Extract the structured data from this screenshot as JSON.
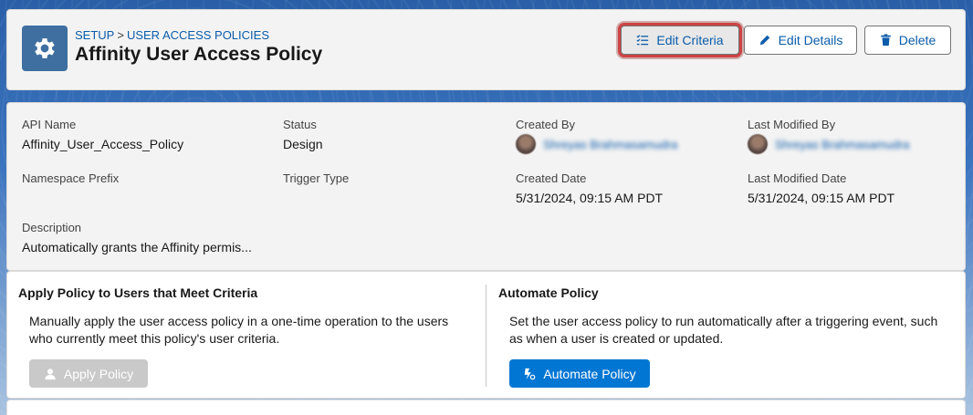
{
  "header": {
    "breadcrumb": {
      "root": "SETUP",
      "separator": ">",
      "current": "USER ACCESS POLICIES"
    },
    "title": "Affinity User Access Policy",
    "icon": "gear-icon",
    "buttons": {
      "edit_criteria": "Edit Criteria",
      "edit_details": "Edit Details",
      "delete": "Delete"
    }
  },
  "details": {
    "api_name": {
      "label": "API Name",
      "value": "Affinity_User_Access_Policy"
    },
    "status": {
      "label": "Status",
      "value": "Design"
    },
    "created_by": {
      "label": "Created By",
      "value": "Shreyas Brahmasamudra"
    },
    "last_modified_by": {
      "label": "Last Modified By",
      "value": "Shreyas Brahmasamudra"
    },
    "namespace_prefix": {
      "label": "Namespace Prefix",
      "value": ""
    },
    "trigger_type": {
      "label": "Trigger Type",
      "value": ""
    },
    "created_date": {
      "label": "Created Date",
      "value": "5/31/2024, 09:15 AM PDT"
    },
    "last_modified_date": {
      "label": "Last Modified Date",
      "value": "5/31/2024, 09:15 AM PDT"
    },
    "description": {
      "label": "Description",
      "value": "Automatically grants the Affinity permis..."
    }
  },
  "apply_section": {
    "title": "Apply Policy to Users that Meet Criteria",
    "text": "Manually apply the user access policy in a one-time operation to the users who currently meet this policy's user criteria.",
    "button": "Apply Policy"
  },
  "automate_section": {
    "title": "Automate Policy",
    "text": "Set the user access policy to run automatically after a triggering event, such as when a user is created or updated.",
    "button": "Automate Policy"
  },
  "colors": {
    "brand": "#0176d3",
    "link": "#0b5cab",
    "highlight": "#cc4444",
    "disabled": "#c9c9c9"
  }
}
